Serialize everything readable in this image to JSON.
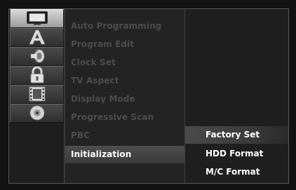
{
  "sidebar": {
    "icons": [
      {
        "name": "tv-display-icon",
        "active": true
      },
      {
        "name": "language-a-icon",
        "active": false
      },
      {
        "name": "speaker-audio-icon",
        "active": false
      },
      {
        "name": "lock-icon",
        "active": false
      },
      {
        "name": "film-frame-icon",
        "active": false
      },
      {
        "name": "disc-icon",
        "active": false
      }
    ]
  },
  "menu": {
    "items": [
      {
        "label": "Auto Programming"
      },
      {
        "label": "Program Edit"
      },
      {
        "label": "Clock Set"
      },
      {
        "label": "TV Aspect"
      },
      {
        "label": "Display Mode"
      },
      {
        "label": "Progressive Scan"
      },
      {
        "label": "PBC"
      },
      {
        "label": "Initialization"
      }
    ],
    "selected": "Initialization"
  },
  "submenu": {
    "items": [
      {
        "label": "Factory Set"
      },
      {
        "label": "HDD Format"
      },
      {
        "label": "M/C Format"
      }
    ],
    "selected": "Factory Set"
  },
  "colors": {
    "active_text": "#ffffff",
    "disabled_text": "#4c4c4c",
    "highlight": "#4a4a4a"
  }
}
